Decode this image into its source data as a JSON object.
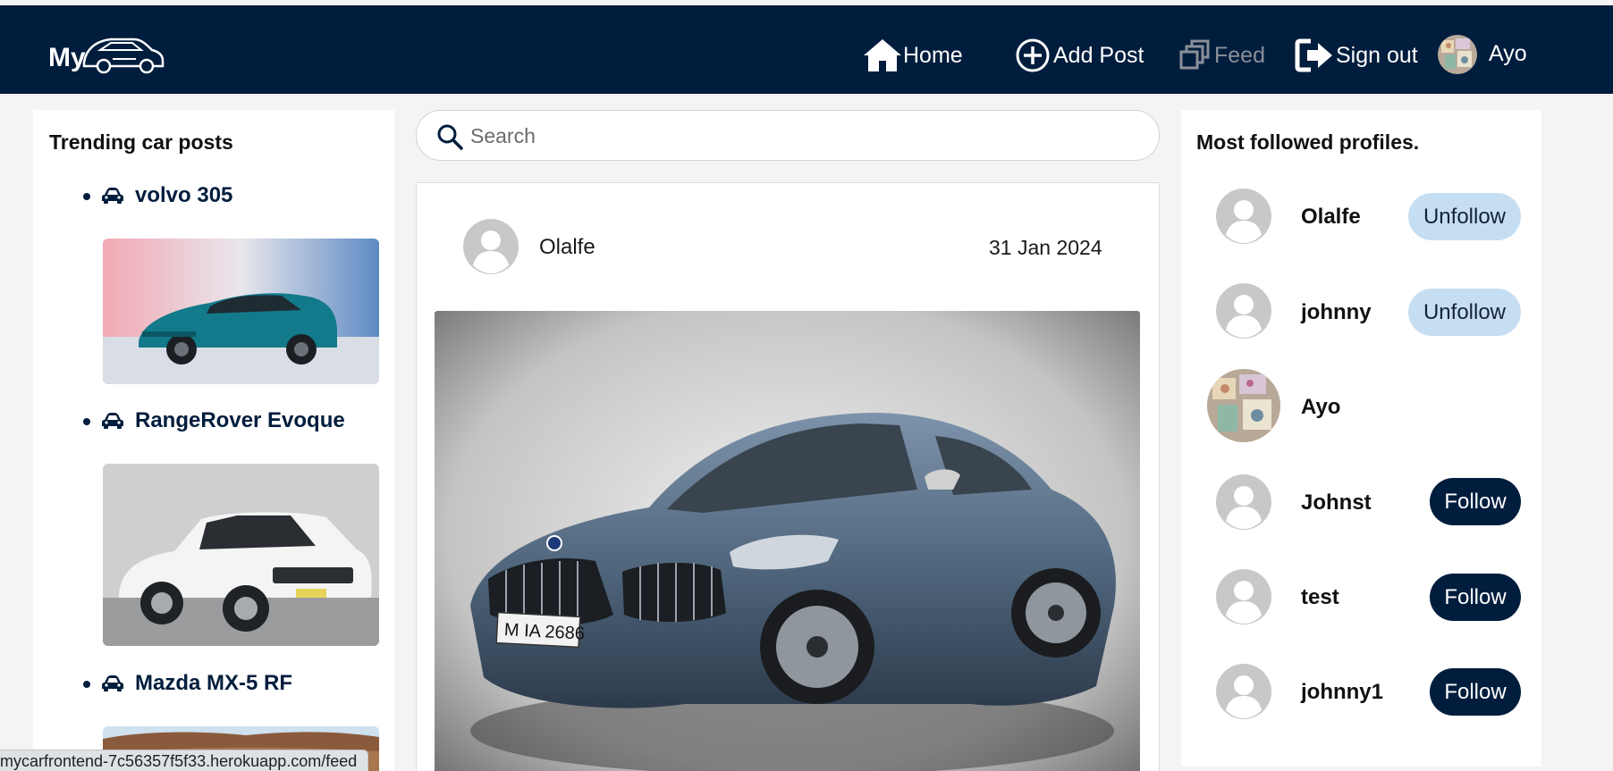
{
  "nav": {
    "logo_text": "My",
    "home_label": "Home",
    "add_post_label": "Add Post",
    "feed_label": "Feed",
    "sign_out_label": "Sign out",
    "username": "Ayo",
    "accent_color": "#001d3d"
  },
  "trending": {
    "title": "Trending car posts",
    "items": [
      {
        "label": "volvo 305",
        "icon": "car-icon"
      },
      {
        "label": "RangeRover Evoque",
        "icon": "car-icon"
      },
      {
        "label": "Mazda MX-5 RF",
        "icon": "car-icon"
      }
    ]
  },
  "search": {
    "placeholder": "Search",
    "value": ""
  },
  "post": {
    "author": "Olalfe",
    "date": "31 Jan 2024",
    "plate_text": "M IA 2686"
  },
  "profiles": {
    "title": "Most followed profiles.",
    "items": [
      {
        "name": "Olalfe",
        "action": "Unfollow"
      },
      {
        "name": "johnny",
        "action": "Unfollow"
      },
      {
        "name": "Ayo",
        "action": ""
      },
      {
        "name": "Johnst",
        "action": "Follow"
      },
      {
        "name": "test",
        "action": "Follow"
      },
      {
        "name": "johnny1",
        "action": "Follow"
      }
    ]
  },
  "statusbar": {
    "url": "mycarfrontend-7c56357f5f33.herokuapp.com/feed"
  }
}
